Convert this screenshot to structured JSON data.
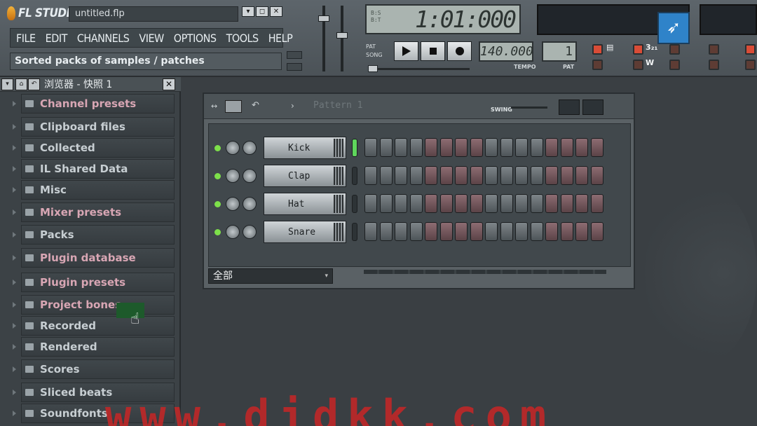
{
  "app": {
    "logo_text": "FL STUDIO",
    "filename": "untitled.flp",
    "window_buttons": [
      "▾",
      "◻",
      "✕"
    ]
  },
  "menu": [
    "FILE",
    "EDIT",
    "CHANNELS",
    "VIEW",
    "OPTIONS",
    "TOOLS",
    "HELP"
  ],
  "hint_text": "Sorted packs of samples / patches",
  "transport": {
    "time": "1:01:000",
    "pat_label": "PAT",
    "song_label": "SONG",
    "tempo": "140.000",
    "tempo_label": "TEMPO",
    "pattern_number": "1",
    "pattern_label": "PAT"
  },
  "browser": {
    "title": "浏览器 - 快照 1",
    "items": [
      {
        "label": "Channel presets",
        "color": "pink"
      },
      {
        "label": "Clipboard files",
        "color": "gray"
      },
      {
        "label": "Collected",
        "color": "gray"
      },
      {
        "label": "IL Shared Data",
        "color": "gray"
      },
      {
        "label": "Misc",
        "color": "gray"
      },
      {
        "label": "Mixer presets",
        "color": "pink"
      },
      {
        "label": "Packs",
        "color": "gray"
      },
      {
        "label": "Plugin database",
        "color": "pink"
      },
      {
        "label": "Plugin presets",
        "color": "pink"
      },
      {
        "label": "Project bones",
        "color": "pink"
      },
      {
        "label": "Recorded",
        "color": "gray"
      },
      {
        "label": "Rendered",
        "color": "gray"
      },
      {
        "label": "Scores",
        "color": "gray"
      },
      {
        "label": "Sliced beats",
        "color": "gray"
      },
      {
        "label": "Soundfonts",
        "color": "gray"
      }
    ]
  },
  "sequencer": {
    "pattern_name": "Pattern 1",
    "swing_label": "SWING",
    "channels": [
      "Kick",
      "Clap",
      "Hat",
      "Snare"
    ],
    "step_colors": [
      "g",
      "g",
      "g",
      "g",
      "r",
      "r",
      "r",
      "r",
      "g",
      "g",
      "g",
      "g",
      "r",
      "r",
      "r",
      "r"
    ],
    "filter_group": "全部"
  },
  "watermark": "www.djdkk.com",
  "colors": {
    "accent_led": "#d94c37",
    "active_green": "#5fd65c",
    "watermark_red": "#c82626"
  }
}
